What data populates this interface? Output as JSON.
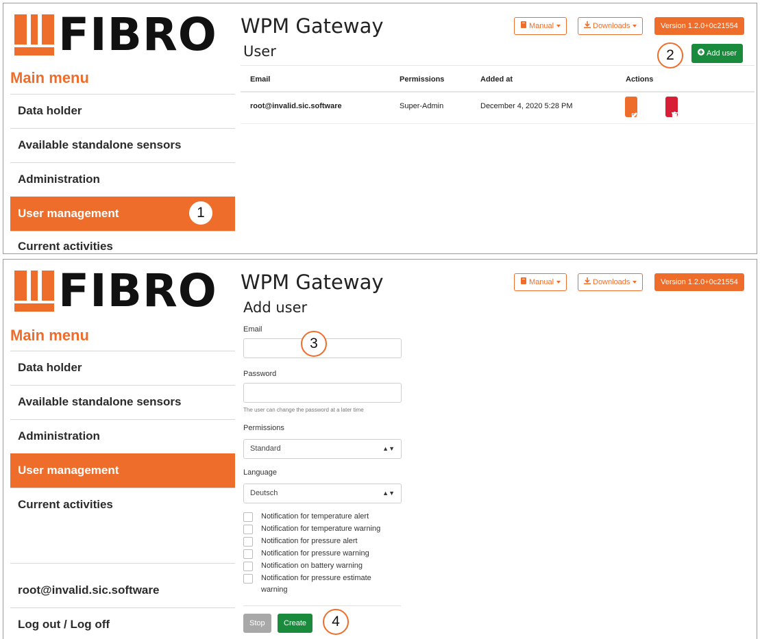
{
  "brand": {
    "logo_text": "FIBRO",
    "accent": "#ef6d2b"
  },
  "app": {
    "title": "WPM Gateway"
  },
  "topbar": {
    "manual": "Manual",
    "downloads": "Downloads",
    "version": "Version 1.2.0+0c21554"
  },
  "menu": {
    "heading": "Main menu",
    "items": [
      "Data holder",
      "Available standalone sensors",
      "Administration",
      "User management",
      "Current activities"
    ],
    "active_index": 3
  },
  "screen1": {
    "page_title": "User",
    "add_user_label": "Add user",
    "table": {
      "headers": [
        "Email",
        "Permissions",
        "Added at",
        "Actions"
      ],
      "rows": [
        {
          "email": "root@invalid.sic.software",
          "permissions": "Super-Admin",
          "added_at": "December 4, 2020 5:28 PM",
          "edit": "Edit",
          "delete": "Delete"
        }
      ]
    }
  },
  "screen2": {
    "page_title": "Add user",
    "email_label": "Email",
    "email_value": "",
    "password_label": "Password",
    "password_value": "",
    "password_hint": "The user can change the password at a later time",
    "permissions_label": "Permissions",
    "permissions_value": "Standard",
    "language_label": "Language",
    "language_value": "Deutsch",
    "notifications": [
      "Notification for temperature alert",
      "Notification for temperature warning",
      "Notification for pressure alert",
      "Notification for pressure warning",
      "Notification on battery warning",
      "Notification for pressure estimate warning"
    ],
    "stop_label": "Stop",
    "create_label": "Create",
    "footer_user": "root@invalid.sic.software",
    "footer_logout": "Log out / Log off"
  },
  "callouts": [
    "1",
    "2",
    "3",
    "4"
  ]
}
